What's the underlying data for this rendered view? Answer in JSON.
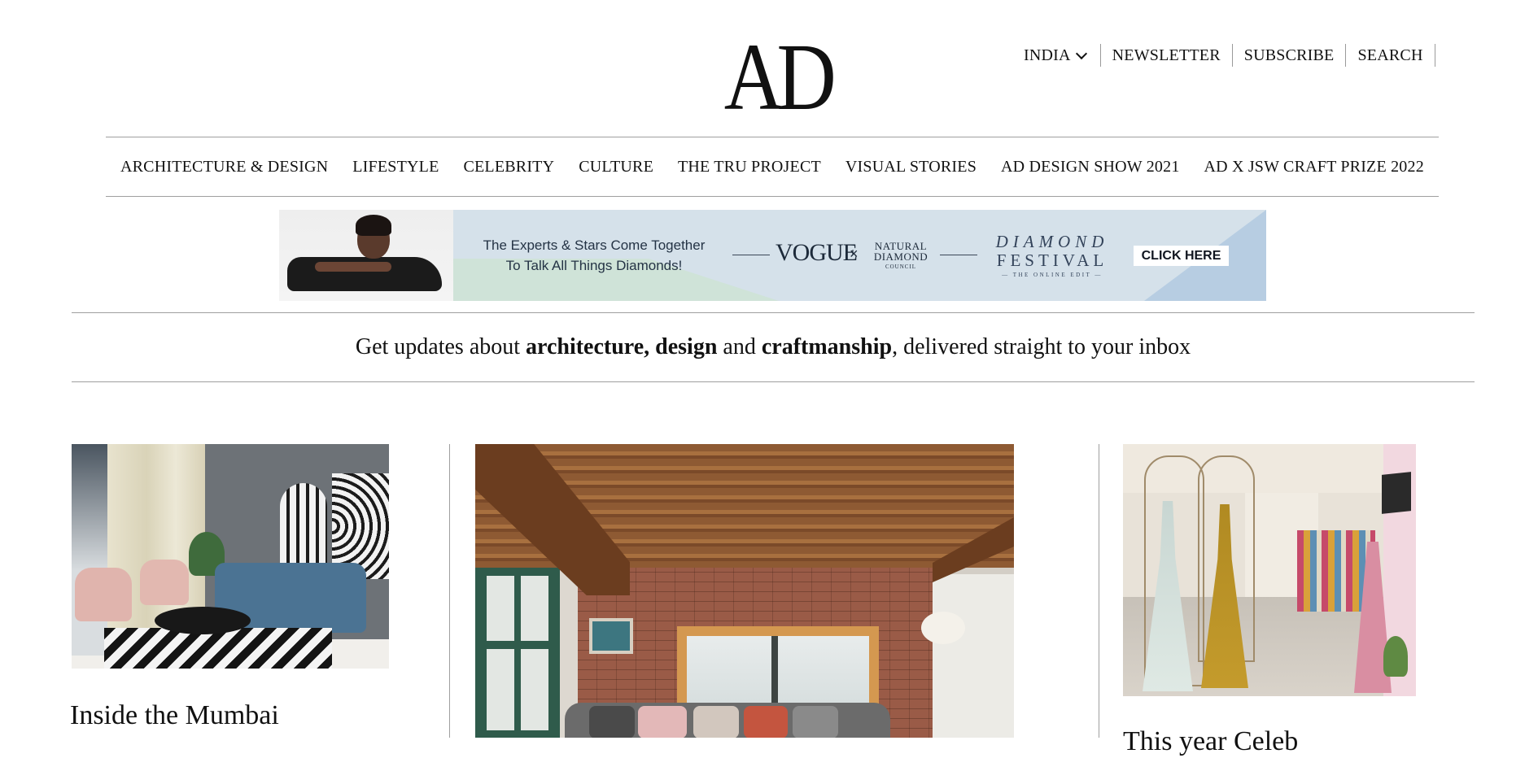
{
  "header": {
    "logo_text": "AD",
    "region": "INDIA",
    "utility_links": [
      "NEWSLETTER",
      "SUBSCRIBE",
      "SEARCH"
    ]
  },
  "main_nav": {
    "items": [
      "ARCHITECTURE & DESIGN",
      "LIFESTYLE",
      "CELEBRITY",
      "CULTURE",
      "THE TRU PROJECT",
      "VISUAL STORIES",
      "AD DESIGN SHOW 2021",
      "AD X JSW CRAFT PRIZE 2022"
    ]
  },
  "ad_banner": {
    "tagline_line1": "The Experts & Stars Come Together",
    "tagline_line2": "To Talk All Things Diamonds!",
    "brand": "VOGUE",
    "x": "×",
    "partner_line1": "NATURAL",
    "partner_line2": "DIAMOND",
    "partner_line3": "COUNCIL",
    "event_line1": "DIAMOND",
    "event_line2": "FESTIVAL",
    "event_line3": "— THE ONLINE EDIT —",
    "cta": "CLICK HERE",
    "colors": {
      "background": "#d5e1ea",
      "accent_green": "#cfe3d8",
      "accent_blue": "#b7cde2"
    }
  },
  "newsletter": {
    "prefix": "Get updates about ",
    "bold1": "architecture, design",
    "middle": " and ",
    "bold2": "craftmanship",
    "suffix": ", delivered straight to your inbox"
  },
  "articles": [
    {
      "headline": "Inside the Mumbai"
    },
    {
      "headline": ""
    },
    {
      "headline": "This year Celeb"
    }
  ]
}
